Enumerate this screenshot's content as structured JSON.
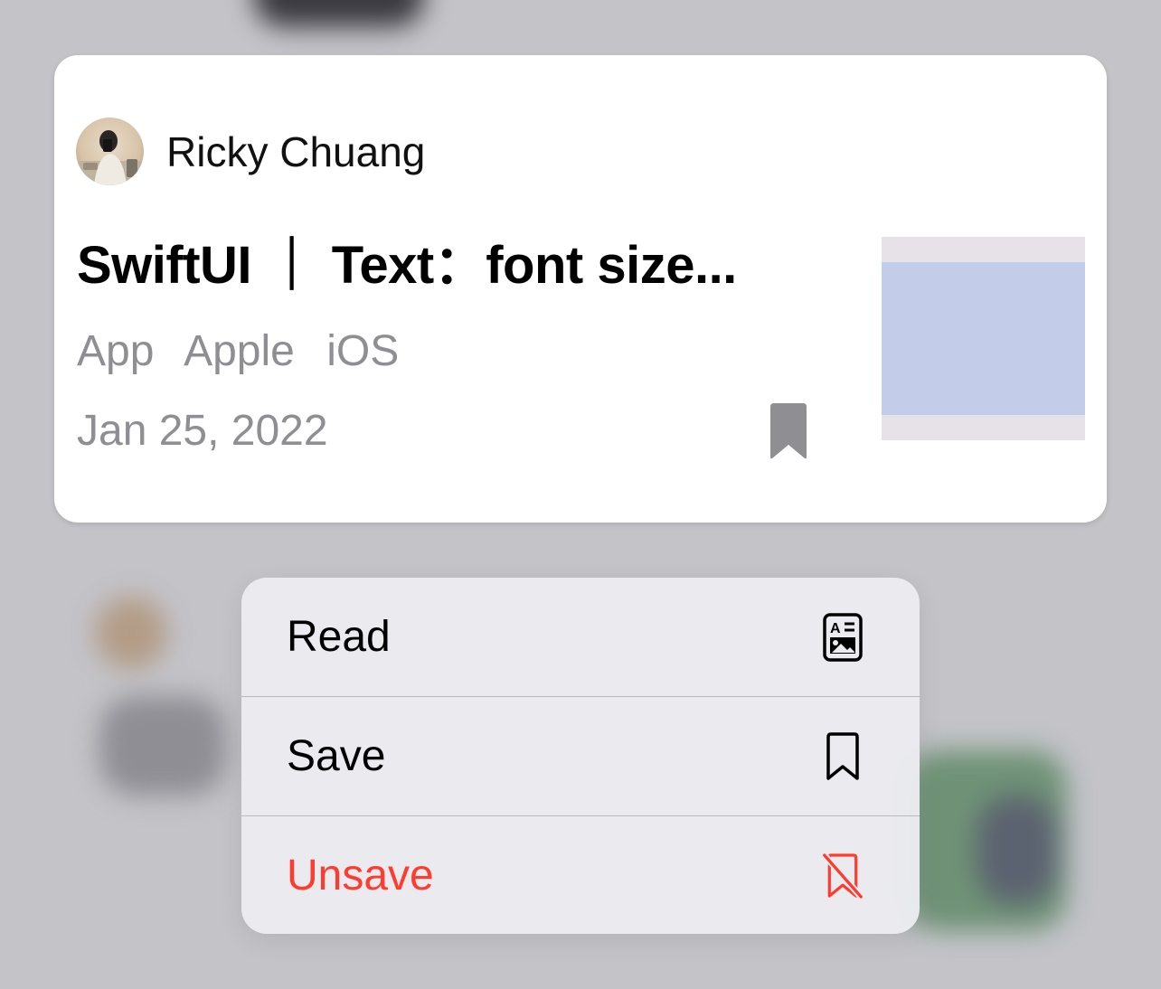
{
  "card": {
    "author": "Ricky Chuang",
    "title": "SwiftUI ｜ Text：font size...",
    "tags": [
      "App",
      "Apple",
      "iOS"
    ],
    "date": "Jan 25, 2022",
    "bookmark_icon": "bookmark-fill-icon",
    "colors": {
      "bookmark": "#8e8e93",
      "thumbnail_border": "#e6e2e8",
      "thumbnail_fill": "#c3cde9"
    }
  },
  "menu": {
    "items": [
      {
        "label": "Read",
        "icon": "doc-richtext-icon",
        "destructive": false
      },
      {
        "label": "Save",
        "icon": "bookmark-icon",
        "destructive": false
      },
      {
        "label": "Unsave",
        "icon": "bookmark-slash-icon",
        "destructive": true
      }
    ],
    "colors": {
      "destructive": "#ff3b30",
      "text": "#000000"
    }
  }
}
